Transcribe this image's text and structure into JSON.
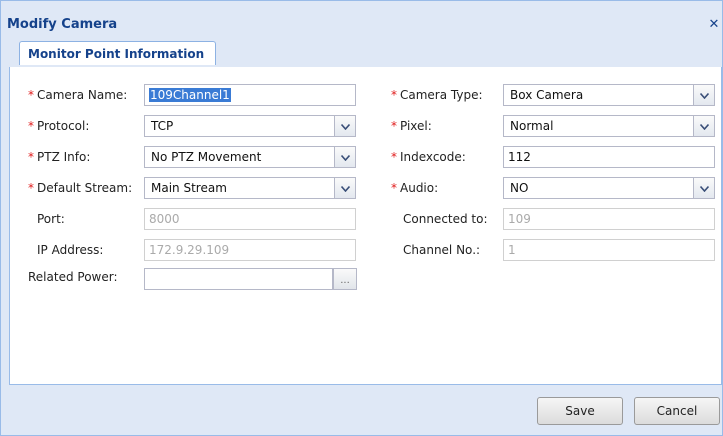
{
  "dialog": {
    "title": "Modify Camera",
    "close_glyph": "✕"
  },
  "tabs": [
    {
      "label": "Monitor Point Information",
      "active": true
    }
  ],
  "form": {
    "camera_name": {
      "label": "Camera Name:",
      "value": "109Channel1",
      "required": true
    },
    "protocol": {
      "label": "Protocol:",
      "value": "TCP",
      "required": true
    },
    "ptz_info": {
      "label": "PTZ Info:",
      "value": "No PTZ Movement",
      "required": true
    },
    "default_stream": {
      "label": "Default Stream:",
      "value": "Main Stream",
      "required": true
    },
    "port": {
      "label": "Port:",
      "value": "8000",
      "disabled": true
    },
    "ip_address": {
      "label": "IP Address:",
      "value": "172.9.29.109",
      "disabled": true
    },
    "related_power": {
      "label": "Related Power:",
      "value": "",
      "button": "..."
    },
    "camera_type": {
      "label": "Camera Type:",
      "value": "Box Camera",
      "required": true
    },
    "pixel": {
      "label": "Pixel:",
      "value": "Normal",
      "required": true
    },
    "indexcode": {
      "label": "Indexcode:",
      "value": "112",
      "required": true
    },
    "audio": {
      "label": "Audio:",
      "value": "NO",
      "required": true
    },
    "connected_to": {
      "label": "Connected to:",
      "value": "109",
      "disabled": true
    },
    "channel_no": {
      "label": "Channel No.:",
      "value": "1",
      "disabled": true
    },
    "required_marker": "*"
  },
  "footer": {
    "save_label": "Save",
    "cancel_label": "Cancel"
  },
  "colors": {
    "title": "#15428b",
    "required": "#e01b1b",
    "frame": "#dfe8f6",
    "border": "#99bbe8"
  }
}
